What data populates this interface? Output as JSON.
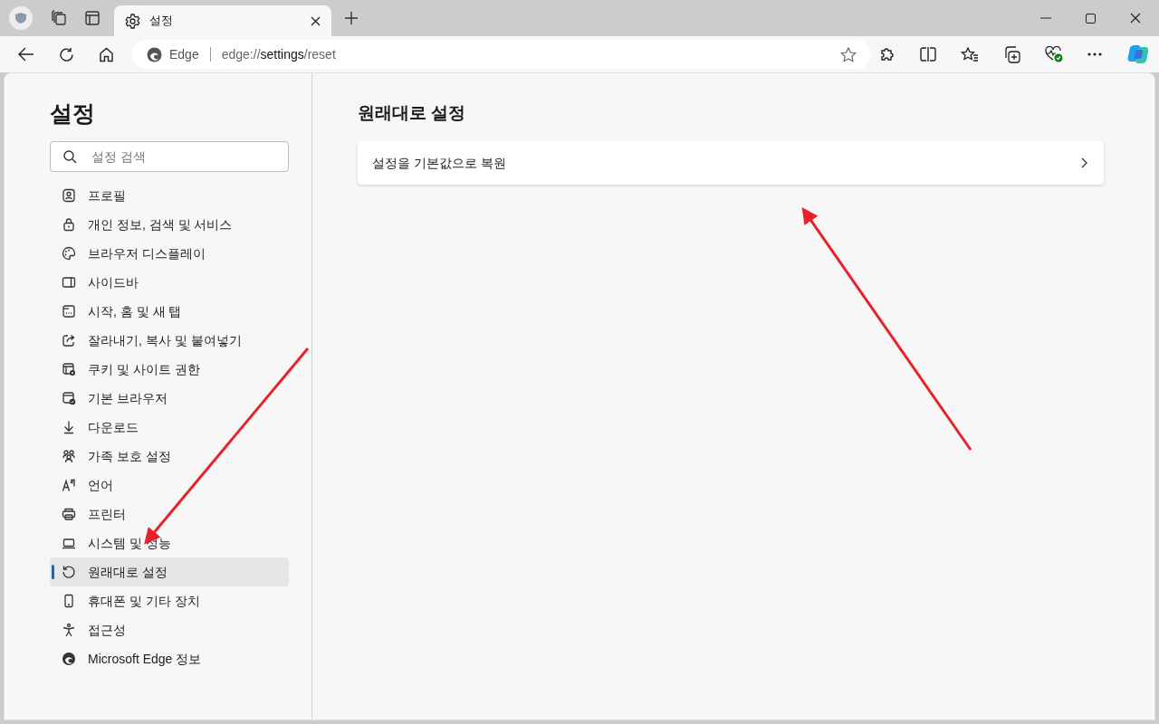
{
  "tabs": [
    {
      "title": "설정",
      "selected": true
    }
  ],
  "address": {
    "badge": "Edge",
    "url": "edge://**settings**/reset"
  },
  "sidebar": {
    "title": "설정",
    "search": {
      "placeholder": "설정 검색"
    },
    "items": [
      {
        "label": "프로필",
        "selected": false
      },
      {
        "label": "개인 정보, 검색 및 서비스",
        "selected": false
      },
      {
        "label": "브라우저 디스플레이",
        "selected": false
      },
      {
        "label": "사이드바",
        "selected": false
      },
      {
        "label": "시작, 홈 및 새 탭",
        "selected": false
      },
      {
        "label": "잘라내기, 복사 및 붙여넣기",
        "selected": false
      },
      {
        "label": "쿠키 및 사이트 권한",
        "selected": false
      },
      {
        "label": "기본 브라우저",
        "selected": false
      },
      {
        "label": "다운로드",
        "selected": false
      },
      {
        "label": "가족 보호 설정",
        "selected": false
      },
      {
        "label": "언어",
        "selected": false
      },
      {
        "label": "프린터",
        "selected": false
      },
      {
        "label": "시스템 및 성능",
        "selected": false
      },
      {
        "label": "원래대로 설정",
        "selected": true
      },
      {
        "label": "휴대폰 및 기타 장치",
        "selected": false
      },
      {
        "label": "접근성",
        "selected": false
      },
      {
        "label": "Microsoft Edge 정보",
        "selected": false
      }
    ]
  },
  "main": {
    "heading": "원래대로 설정",
    "rows": [
      {
        "label": "설정을 기본값으로 복원"
      }
    ]
  }
}
